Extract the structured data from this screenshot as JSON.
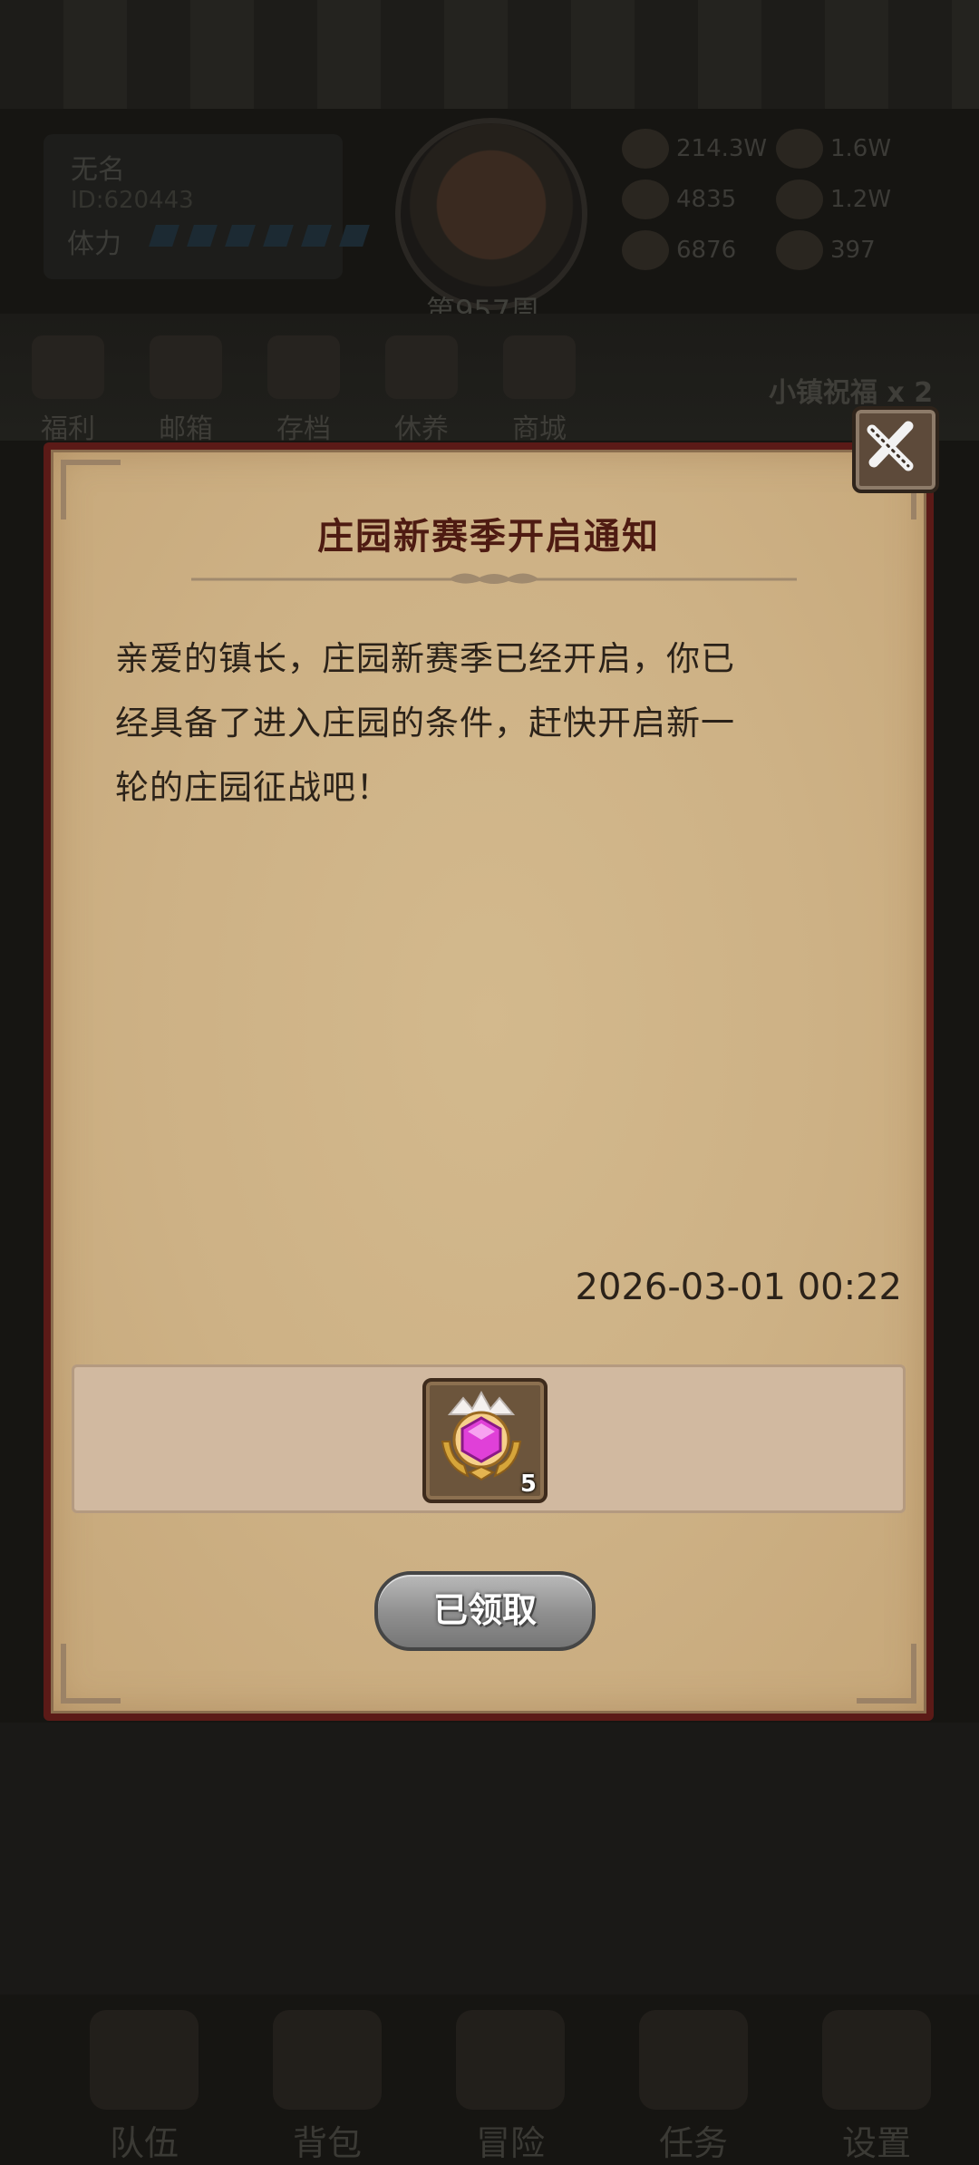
{
  "background": {
    "player": {
      "name": "无名",
      "id": "ID:620443",
      "stamina_label": "体力"
    },
    "week_label": "第957周",
    "resources": [
      "214.3W",
      "1.6W",
      "4835",
      "1.2W",
      "6876",
      "397"
    ],
    "quick_menu": [
      "福利",
      "邮箱",
      "存档",
      "休养",
      "商城"
    ],
    "blessing_text": "小镇祝福 x 2",
    "bottom_nav": [
      "队伍",
      "背包",
      "冒险",
      "任务",
      "设置"
    ]
  },
  "dialog": {
    "title": "庄园新赛季开启通知",
    "message_lines": [
      "亲爱的镇长，庄园新赛季已经开启，你已",
      "经具备了进入庄园的条件，赶快开启新一",
      "轮的庄园征战吧！"
    ],
    "timestamp": "2026-03-01 00:22",
    "reward": {
      "icon": "purple-gem-emblem-icon",
      "count": "5"
    },
    "claim_button_label": "已领取",
    "close_icon": "close-icon"
  },
  "colors": {
    "paper": "#cdb185",
    "title": "#4e1b12",
    "frame": "#5b1a17",
    "gem": "#e040d8"
  }
}
